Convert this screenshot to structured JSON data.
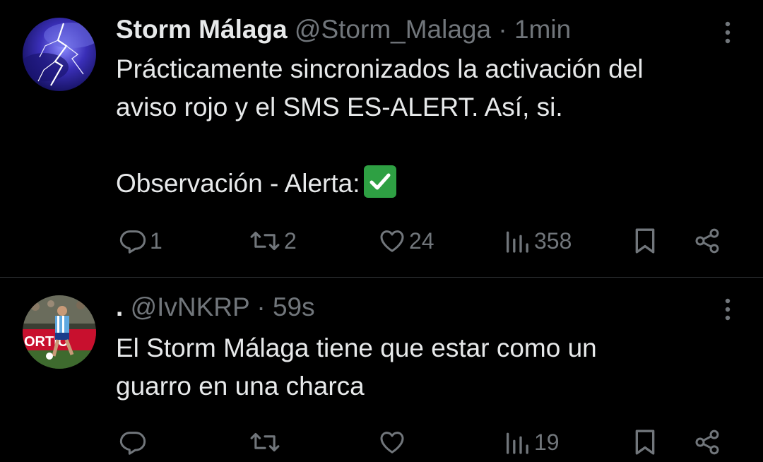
{
  "tweets": [
    {
      "display_name": "Storm Málaga",
      "handle": "@Storm_Malaga",
      "separator": "·",
      "time": "1min",
      "text_lines": [
        "Prácticamente sincronizados la activación del",
        "aviso rojo y el SMS ES-ALERT. Así, si.",
        "",
        "Observación - Alerta:"
      ],
      "emoji": "check-mark-button",
      "stats": {
        "replies": "1",
        "reposts": "2",
        "likes": "24",
        "views": "358"
      }
    },
    {
      "display_name": ".",
      "handle": "@IvNKRP",
      "separator": "·",
      "time": "59s",
      "text_lines": [
        "El Storm Málaga tiene que estar como un",
        "guarro en una charca"
      ],
      "stats": {
        "replies": "",
        "reposts": "",
        "likes": "",
        "views": "19"
      }
    }
  ],
  "colors": {
    "background": "#000000",
    "text": "#e7e9ea",
    "secondary": "#71767b",
    "divider": "#2f3336",
    "check": "#2ea043"
  },
  "icons": [
    "reply-icon",
    "repost-icon",
    "like-icon",
    "views-icon",
    "bookmark-icon",
    "share-icon",
    "more-icon"
  ]
}
